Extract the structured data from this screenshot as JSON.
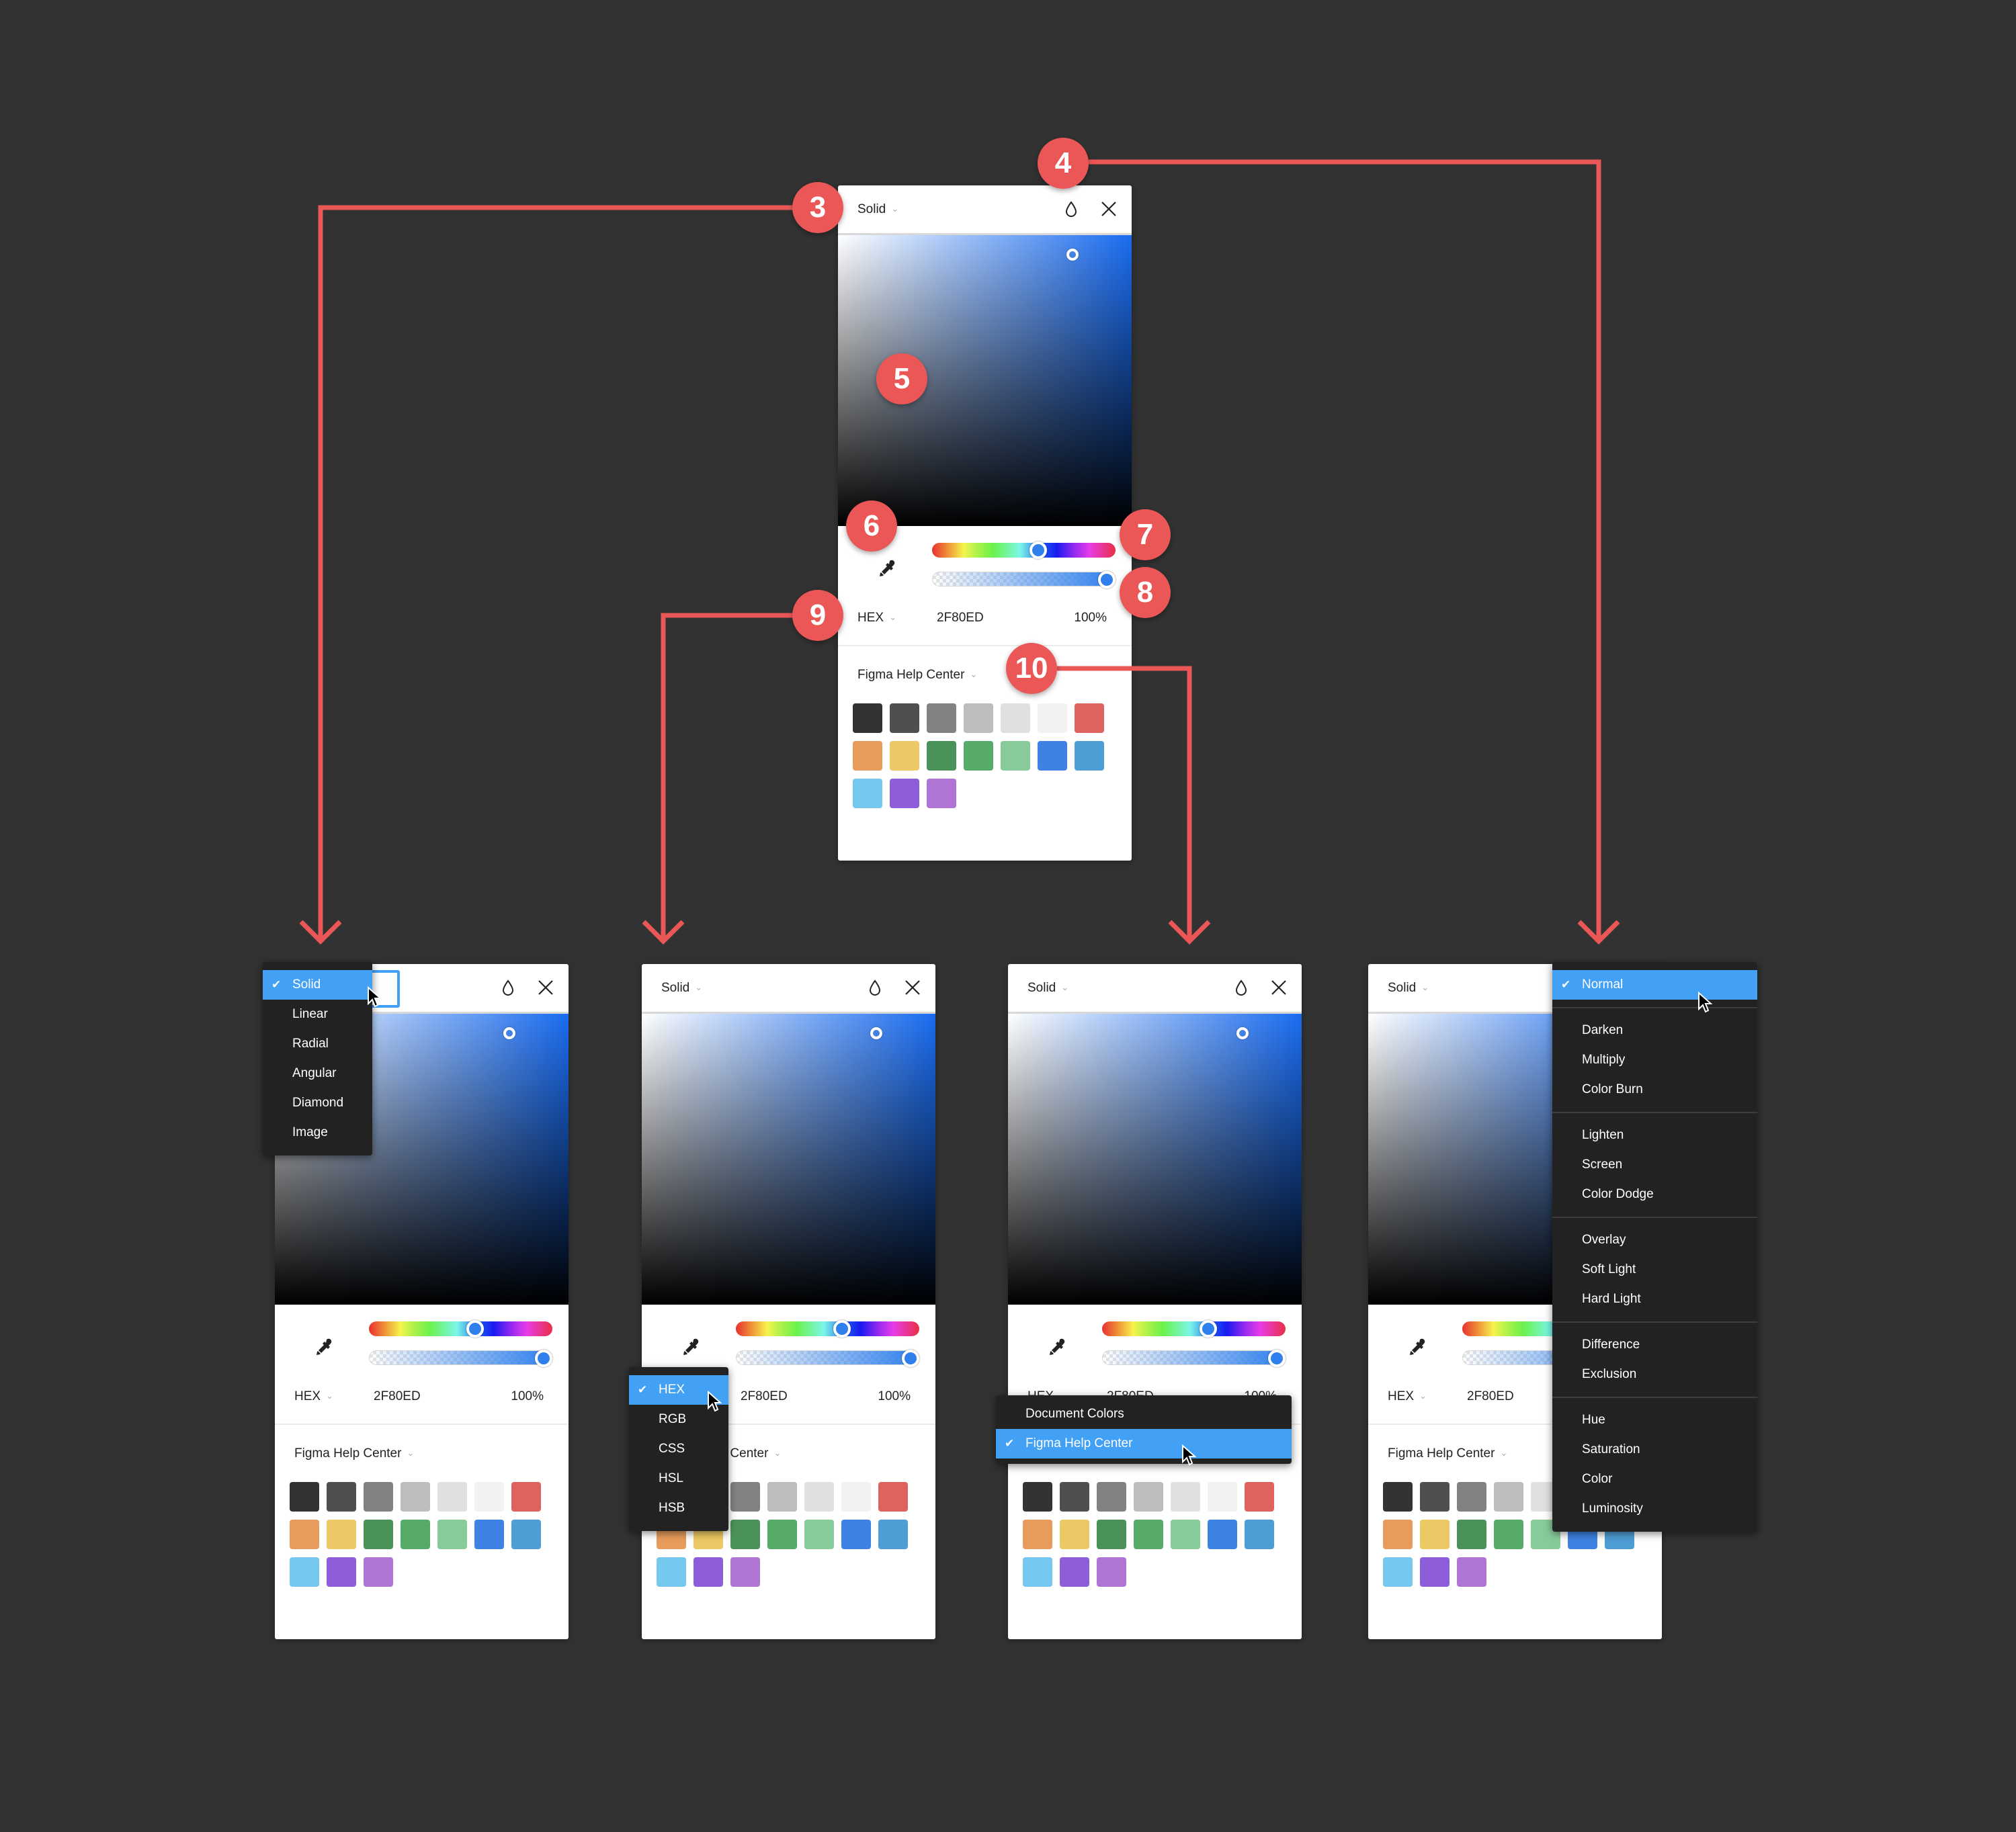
{
  "callouts": [
    "3",
    "4",
    "5",
    "6",
    "7",
    "8",
    "9",
    "10"
  ],
  "picker": {
    "fill_type": "Solid",
    "format": "HEX",
    "hex_value": "2F80ED",
    "opacity": "100%",
    "hue_position": 0.58,
    "alpha_position": 1.0,
    "library": "Figma Help Center",
    "icons": {
      "blend": "droplet-icon",
      "close": "close-icon",
      "eyedropper": "eyedropper-icon",
      "chevron": "chevron-down-icon"
    },
    "chevron_glyph": "⌄",
    "swatches": [
      "#333333",
      "#4f4f4f",
      "#828282",
      "#bdbdbd",
      "#e0e0e0",
      "#f2f2f2",
      "#eb5757",
      "#f2994a",
      "#f2c94c",
      "#219653",
      "#27ae60",
      "#6fcf97",
      "#2f80ed",
      "#2d9cdb",
      "#56ccf2",
      "#9b51e0",
      "#bb6bd9"
    ],
    "swatch_display": [
      "#333333",
      "#4f4f4f",
      "#828282",
      "#bdbdbd",
      "#e0e0e0",
      "#f2f2f2",
      "#de625e",
      "#e89c5b",
      "#ecc964",
      "#4b9259",
      "#56ab69",
      "#88cb9a",
      "#3e83e4",
      "#4e9ed6",
      "#75c9ef",
      "#8e5dd9",
      "#b074d4"
    ]
  },
  "menus": {
    "fill_type": {
      "items": [
        "Solid",
        "Linear",
        "Radial",
        "Angular",
        "Diamond",
        "Image"
      ],
      "selected": "Solid"
    },
    "color_format": {
      "items": [
        "HEX",
        "RGB",
        "CSS",
        "HSL",
        "HSB"
      ],
      "selected": "HEX"
    },
    "library": {
      "items": [
        "Document Colors",
        "Figma Help Center"
      ],
      "selected": "Figma Help Center"
    },
    "blend_mode": {
      "groups": [
        [
          "Normal"
        ],
        [
          "Darken",
          "Multiply",
          "Color Burn"
        ],
        [
          "Lighten",
          "Screen",
          "Color Dodge"
        ],
        [
          "Overlay",
          "Soft Light",
          "Hard Light"
        ],
        [
          "Difference",
          "Exclusion"
        ],
        [
          "Hue",
          "Saturation",
          "Color",
          "Luminosity"
        ]
      ],
      "selected": "Normal"
    }
  },
  "check_glyph": "✔"
}
